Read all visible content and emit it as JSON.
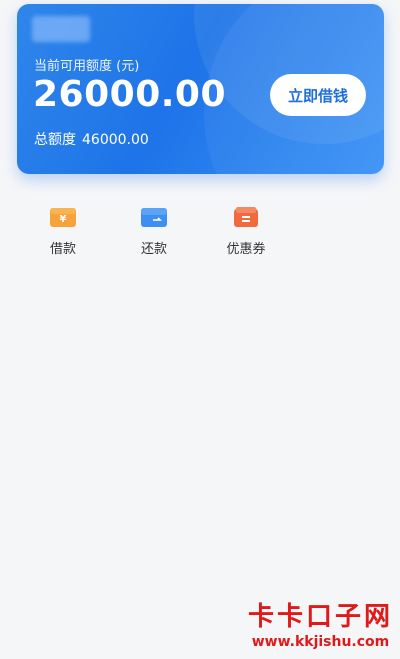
{
  "card": {
    "available_label": "当前可用额度 (元)",
    "available_amount": "26000.00",
    "total_label": "总额度",
    "total_amount": "46000.00",
    "borrow_button_label": "立即借钱"
  },
  "quick_actions": [
    {
      "label": "借款",
      "icon": "wallet-icon",
      "color": "#f29b2e"
    },
    {
      "label": "还款",
      "icon": "card-icon",
      "color": "#3f8ff0"
    },
    {
      "label": "优惠券",
      "icon": "coupon-icon",
      "color": "#f06a3e"
    }
  ],
  "watermark": {
    "title": "卡卡口子网",
    "url": "www.kkjishu.com"
  },
  "colors": {
    "card_gradient_start": "#2f86ea",
    "card_gradient_end": "#3a92f6",
    "button_text": "#1e6fe0",
    "watermark": "#e01a1a"
  }
}
